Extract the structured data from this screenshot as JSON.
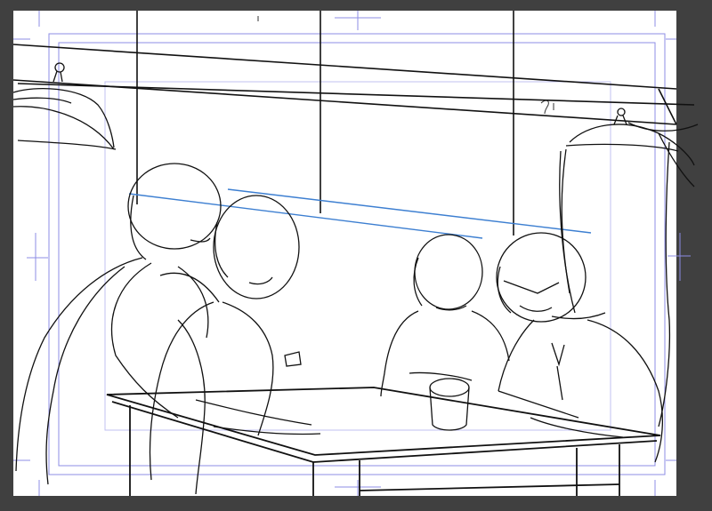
{
  "canvas": {
    "background": "#404040",
    "paper": "#ffffff",
    "guide_color": "#8c8ce6",
    "ink_color": "#111111",
    "perspective_color": "#3d7fd1"
  },
  "scene": {
    "subjects": [
      "person-back-left",
      "person-front-left",
      "person-center-right",
      "person-right"
    ],
    "objects": [
      "table",
      "pendant-lamp-left",
      "pendant-lamp-right",
      "window-frame",
      "cup"
    ]
  }
}
